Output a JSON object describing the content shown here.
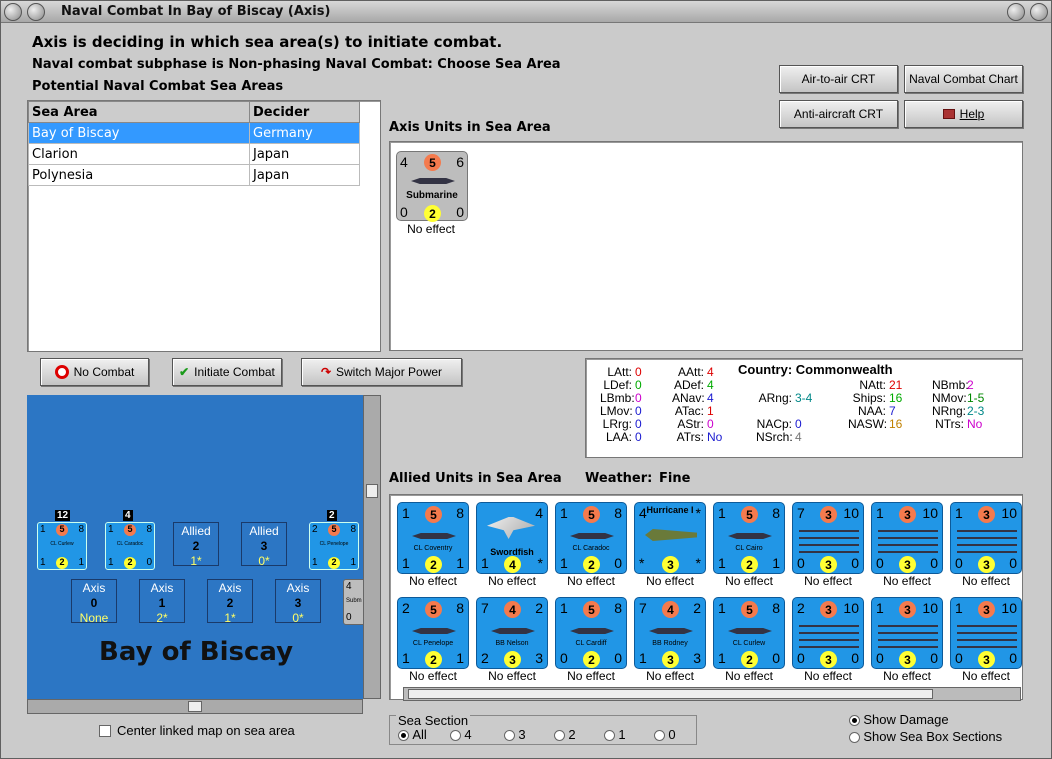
{
  "window": {
    "title": "Naval Combat In Bay of Biscay (Axis)"
  },
  "header": {
    "line1": "Axis is deciding in which sea area(s) to initiate combat.",
    "line2": "Naval combat subphase is Non-phasing Naval Combat: Choose Sea Area",
    "line3": "Potential Naval Combat Sea Areas"
  },
  "buttons": {
    "air_to_air": "Air-to-air CRT",
    "naval_chart": "Naval Combat Chart",
    "anti_aircraft": "Anti-aircraft CRT",
    "help": "Help",
    "no_combat": "No Combat",
    "initiate": "Initiate Combat",
    "switch": "Switch Major Power"
  },
  "table": {
    "headers": [
      "Sea Area",
      "Decider"
    ],
    "rows": [
      [
        "Bay of Biscay",
        "Germany"
      ],
      [
        "Clarion",
        "Japan"
      ],
      [
        "Polynesia",
        "Japan"
      ]
    ]
  },
  "axis": {
    "label": "Axis Units in Sea Area",
    "unit": {
      "tl": "4",
      "tm": "5",
      "tr": "6",
      "name": "Submarine",
      "bl": "0",
      "bm": "2",
      "br": "0",
      "effect": "No effect"
    }
  },
  "stats": {
    "country_label": "Country:",
    "country": "Commonwealth",
    "c1": [
      [
        "LAtt:",
        "0"
      ],
      [
        "LDef:",
        "0"
      ],
      [
        "LBmb:",
        "0"
      ],
      [
        "LMov:",
        "0"
      ],
      [
        "LRrg:",
        "0"
      ],
      [
        "LAA:",
        "0"
      ]
    ],
    "c2": [
      [
        "AAtt:",
        "4"
      ],
      [
        "ADef:",
        "4"
      ],
      [
        "ANav:",
        "4"
      ],
      [
        "ATac:",
        "1"
      ],
      [
        "AStr:",
        "0"
      ],
      [
        "ATrs:",
        "No"
      ]
    ],
    "c3": [
      [
        "ARng:",
        "3-4"
      ],
      [
        "NACp:",
        "0"
      ],
      [
        "NSrch:",
        "4"
      ]
    ],
    "c4": [
      [
        "NAtt:",
        "21"
      ],
      [
        "Ships:",
        "16"
      ],
      [
        "NAA:",
        "7"
      ],
      [
        "NASW:",
        "16"
      ]
    ],
    "c5": [
      [
        "NBmb:",
        "2"
      ],
      [
        "NMov:",
        "1-5"
      ],
      [
        "NRng:",
        "2-3"
      ],
      [
        "NTrs:",
        "No"
      ]
    ]
  },
  "allied": {
    "label": "Allied Units in Sea Area",
    "weather_label": "Weather:",
    "weather": "Fine",
    "row1": [
      {
        "tl": "1",
        "tm": "5",
        "tr": "8",
        "name": "CL Coventry",
        "bl": "1",
        "bm": "2",
        "br": "1",
        "effect": "No effect"
      },
      {
        "tl": "",
        "tm": "",
        "tr": "4",
        "name": "Swordfish",
        "bl": "1",
        "bm": "4",
        "br": "*",
        "effect": "No effect"
      },
      {
        "tl": "1",
        "tm": "5",
        "tr": "8",
        "name": "CL Caradoc",
        "bl": "1",
        "bm": "2",
        "br": "0",
        "effect": "No effect"
      },
      {
        "tl": "4",
        "tm": "",
        "tr": "*",
        "name": "Hurricane I",
        "bl": "*",
        "bm": "3",
        "br": "*",
        "effect": "No effect"
      },
      {
        "tl": "1",
        "tm": "5",
        "tr": "8",
        "name": "CL Cairo",
        "bl": "1",
        "bm": "2",
        "br": "1",
        "effect": "No effect"
      },
      {
        "tl": "7",
        "tm": "3",
        "tr": "10",
        "name": "",
        "bl": "0",
        "bm": "3",
        "br": "0",
        "effect": "No effect"
      },
      {
        "tl": "1",
        "tm": "3",
        "tr": "10",
        "name": "",
        "bl": "0",
        "bm": "3",
        "br": "0",
        "effect": "No effect"
      },
      {
        "tl": "1",
        "tm": "3",
        "tr": "10",
        "name": "",
        "bl": "0",
        "bm": "3",
        "br": "0",
        "effect": "No effect"
      }
    ],
    "row2": [
      {
        "tl": "2",
        "tm": "5",
        "tr": "8",
        "name": "CL Penelope",
        "bl": "1",
        "bm": "2",
        "br": "1",
        "effect": "No effect"
      },
      {
        "tl": "7",
        "tm": "4",
        "tr": "2",
        "name": "BB Nelson",
        "bl": "2",
        "bm": "3",
        "br": "3",
        "effect": "No effect"
      },
      {
        "tl": "1",
        "tm": "5",
        "tr": "8",
        "name": "CL Cardiff",
        "bl": "0",
        "bm": "2",
        "br": "0",
        "effect": "No effect"
      },
      {
        "tl": "7",
        "tm": "4",
        "tr": "2",
        "name": "BB Rodney",
        "bl": "1",
        "bm": "3",
        "br": "3",
        "effect": "No effect"
      },
      {
        "tl": "1",
        "tm": "5",
        "tr": "8",
        "name": "CL Curlew",
        "bl": "1",
        "bm": "2",
        "br": "0",
        "effect": "No effect"
      },
      {
        "tl": "2",
        "tm": "3",
        "tr": "10",
        "name": "",
        "bl": "0",
        "bm": "3",
        "br": "0",
        "effect": "No effect"
      },
      {
        "tl": "1",
        "tm": "3",
        "tr": "10",
        "name": "",
        "bl": "0",
        "bm": "3",
        "br": "0",
        "effect": "No effect"
      },
      {
        "tl": "1",
        "tm": "3",
        "tr": "10",
        "name": "",
        "bl": "0",
        "bm": "3",
        "br": "0",
        "effect": "No effect"
      }
    ]
  },
  "map": {
    "title": "Bay of Biscay",
    "units": [
      {
        "count": "12",
        "name": "CL Curlew",
        "tl": "1",
        "tm": "5",
        "tr": "8",
        "bl": "1",
        "bm": "2",
        "br": "1"
      },
      {
        "count": "4",
        "name": "CL Caradoc",
        "tl": "1",
        "tm": "5",
        "tr": "8",
        "bl": "1",
        "bm": "2",
        "br": "0"
      },
      {
        "count": "2",
        "name": "CL Penelope",
        "tl": "2",
        "tm": "5",
        "tr": "8",
        "bl": "1",
        "bm": "2",
        "br": "1"
      }
    ],
    "allied_boxes": [
      {
        "side": "Allied",
        "num": "2",
        "val": "1*"
      },
      {
        "side": "Allied",
        "num": "3",
        "val": "0*"
      }
    ],
    "axis_boxes": [
      {
        "side": "Axis",
        "num": "0",
        "val": "None"
      },
      {
        "side": "Axis",
        "num": "1",
        "val": "2*"
      },
      {
        "side": "Axis",
        "num": "2",
        "val": "1*"
      },
      {
        "side": "Axis",
        "num": "3",
        "val": "0*"
      }
    ],
    "edge_unit": {
      "tl": "4",
      "name": "Subm",
      "bl": "0"
    }
  },
  "center_map": "Center linked map on sea area",
  "sea_section": {
    "label": "Sea Section",
    "options": [
      "All",
      "4",
      "3",
      "2",
      "1",
      "0"
    ]
  },
  "show": {
    "damage": "Show Damage",
    "sections": "Show Sea Box Sections"
  }
}
